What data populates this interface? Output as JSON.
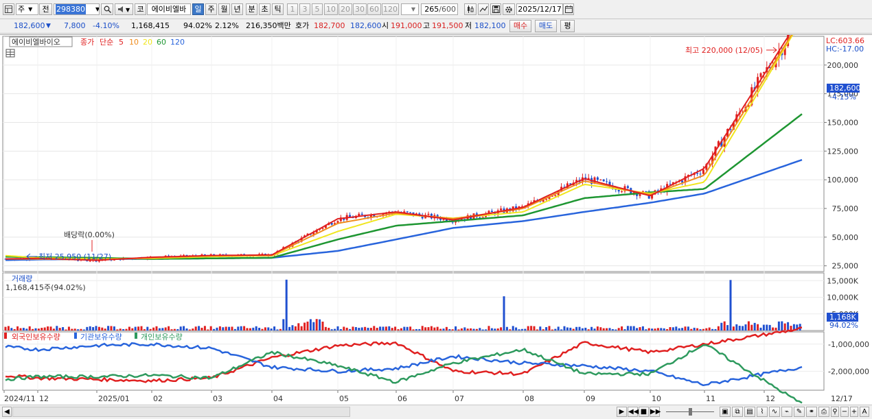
{
  "toolbar": {
    "market": "주",
    "prev": "전",
    "code": "298380",
    "stock_name": "에이비엘바",
    "btn_ko": "코",
    "periods": [
      "일",
      "주",
      "월",
      "년",
      "분",
      "초",
      "틱"
    ],
    "active_period": "일",
    "intervals": [
      "1",
      "3",
      "5",
      "10",
      "20",
      "30",
      "60",
      "120"
    ],
    "count": "265",
    "count_total": "/600",
    "date": "2025/12/17"
  },
  "quote": {
    "price": "182,600",
    "change": "7,800",
    "change_pct": "-4.10%",
    "volume": "1,168,415",
    "vol_ratio": "94.02%",
    "turnover_pct": "2.12%",
    "amount": "216,350백만",
    "ask_label": "호가",
    "ask": "182,700",
    "bid": "182,600",
    "open_label": "시",
    "open": "191,000",
    "high_label": "고",
    "high": "191,500",
    "low_label": "저",
    "low": "182,100",
    "buy": "매수",
    "sell": "매도",
    "avg": "평"
  },
  "colors": {
    "up": "#e02020",
    "down": "#2050d0",
    "ma5": "#e02020",
    "ma10": "#f08c1e",
    "ma20": "#f0e61e",
    "ma60": "#1e9632",
    "ma120": "#2864dc",
    "foreign": "#e02020",
    "institution": "#2864dc",
    "individual": "#2e9a5e"
  },
  "chart_data": [
    {
      "type": "line",
      "title": "에이비엘바이오",
      "legend": [
        "종가",
        "단순",
        "5",
        "10",
        "20",
        "60",
        "120"
      ],
      "x": [
        "2024/11",
        "12",
        "2025/01",
        "02",
        "03",
        "04",
        "05",
        "06",
        "07",
        "08",
        "09",
        "10",
        "11",
        "12"
      ],
      "series": [
        {
          "name": "5",
          "values": [
            31000,
            31500,
            29800,
            32500,
            34000,
            34500,
            66000,
            72000,
            65000,
            76000,
            101000,
            86000,
            110000,
            192000
          ]
        },
        {
          "name": "10",
          "values": [
            31000,
            31000,
            30200,
            32000,
            33800,
            34200,
            62000,
            71000,
            66000,
            75000,
            99000,
            87000,
            104000,
            188000
          ]
        },
        {
          "name": "20",
          "values": [
            34000,
            32000,
            31000,
            31500,
            33000,
            33800,
            55000,
            70000,
            66500,
            72000,
            96000,
            88000,
            98000,
            185000
          ]
        },
        {
          "name": "60",
          "values": [
            33000,
            32500,
            32000,
            31000,
            31500,
            32000,
            48000,
            60000,
            64000,
            69000,
            84000,
            89000,
            92000,
            132000
          ]
        },
        {
          "name": "120",
          "values": [
            30000,
            30500,
            31000,
            31000,
            31500,
            32000,
            38000,
            48000,
            58000,
            64000,
            72000,
            80000,
            88000,
            106000
          ]
        }
      ],
      "ylim": [
        20000,
        225000
      ],
      "yticks": [
        "200,000",
        "175,000",
        "150,000",
        "125,000",
        "100,000",
        "75,000",
        "50,000",
        "25,000"
      ],
      "annotations": {
        "high": "최고 220,000 (12/05)",
        "low": "최저 25,950 (11/27)",
        "dividend": "배당락(0.00%)"
      },
      "current_price": "182,600",
      "current_change": "-4.15%",
      "lc": "LC:603.66",
      "hc": "HC:-17.00"
    },
    {
      "type": "bar",
      "title": "거래량",
      "value_label": "1,168,415주(94.02%)",
      "yticks": [
        "15,000K",
        "10,000K",
        "5,000K"
      ],
      "current": "1,168K",
      "current_pct": "94.02%",
      "peaks": [
        {
          "x": "04",
          "value": 15300000
        },
        {
          "x": "08",
          "value": 10300000
        },
        {
          "x": "11",
          "value": 15200000
        }
      ]
    },
    {
      "type": "line",
      "series": [
        {
          "name": "외국인보유수량",
          "values": [
            -2150000,
            -2250000,
            -2300000,
            -2350000,
            -2250000,
            -1500000,
            -1050000,
            -950000,
            -2000000,
            -2100000,
            -950000,
            -1300000,
            -1000000,
            -650000
          ]
        },
        {
          "name": "기관보유수량",
          "values": [
            -1100000,
            -1200000,
            -1050000,
            -1000000,
            -1150000,
            -1850000,
            -2000000,
            -1900000,
            -1450000,
            -1700000,
            -1800000,
            -2000000,
            -2500000,
            -2100000
          ]
        },
        {
          "name": "개인보유수량",
          "values": [
            -2300000,
            -2200000,
            -2200000,
            -2150000,
            -2250000,
            -1300000,
            -1800000,
            -2400000,
            -1700000,
            -1200000,
            -2100000,
            -2100000,
            -1000000,
            -2350000
          ]
        }
      ],
      "yticks": [
        "-1,000,000",
        "-2,000,000"
      ]
    }
  ],
  "xaxis": {
    "labels": [
      "2024/11",
      "12",
      "2025/01",
      "02",
      "03",
      "04",
      "05",
      "06",
      "07",
      "08",
      "09",
      "10",
      "11",
      "12"
    ],
    "right_label": "12/17"
  }
}
